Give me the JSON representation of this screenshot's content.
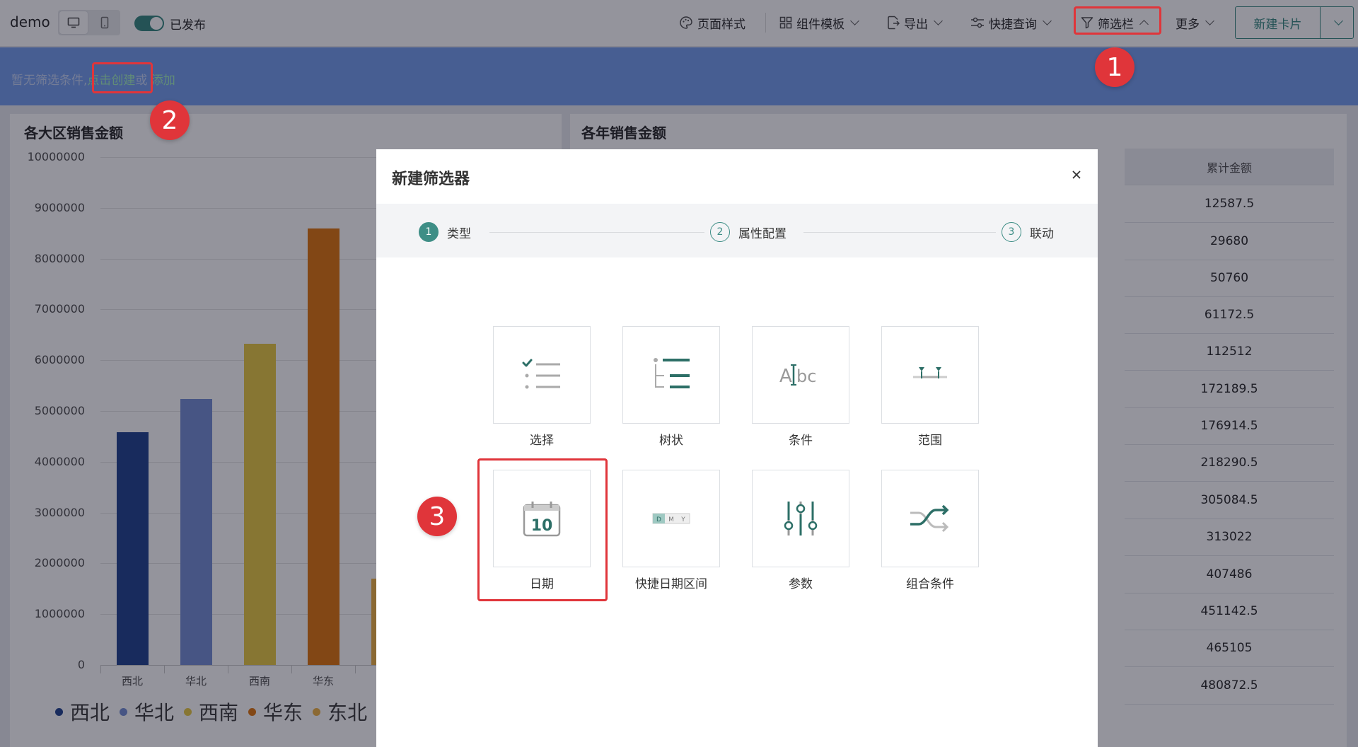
{
  "topbar": {
    "title": "demo",
    "publish_label": "已发布",
    "page_style": "页面样式",
    "component_template": "组件模板",
    "export": "导出",
    "quick_query": "快捷查询",
    "filter_bar": "筛选栏",
    "more": "更多",
    "new_card": "新建卡片"
  },
  "filterbar": {
    "empty_text": "暂无筛选条件,",
    "create_link": "点击创建",
    "or_text": "或",
    "add_link": "添加"
  },
  "left_panel": {
    "title": "各大区销售金额",
    "legend": [
      {
        "name": "西北",
        "color": "#2a4b93"
      },
      {
        "name": "华北",
        "color": "#7a93d6"
      },
      {
        "name": "西南",
        "color": "#e8cc4a"
      },
      {
        "name": "华东",
        "color": "#e07a18"
      },
      {
        "name": "东北",
        "color": "#f0b54a"
      }
    ]
  },
  "chart_data": {
    "type": "bar",
    "title": "各大区销售金额",
    "categories": [
      "西北",
      "华北",
      "西南",
      "华东",
      "东北"
    ],
    "values": [
      4580000,
      5230000,
      6330000,
      8600000,
      1700000
    ],
    "colors": [
      "#2a4b93",
      "#7a93d6",
      "#e8cc4a",
      "#e07a18",
      "#f0b54a"
    ],
    "ylim": [
      0,
      10000000
    ],
    "yticks": [
      "10000000",
      "9000000",
      "8000000",
      "7000000",
      "6000000",
      "5000000",
      "4000000",
      "3000000",
      "2000000",
      "1000000",
      "0"
    ],
    "grid": true
  },
  "right_panel": {
    "title": "各年销售金额",
    "column_header": "累计金额",
    "rows": [
      "12587.5",
      "29680",
      "50760",
      "61172.5",
      "112512",
      "172189.5",
      "176914.5",
      "218290.5",
      "305084.5",
      "313022",
      "407486",
      "451142.5",
      "465105",
      "480872.5"
    ]
  },
  "modal": {
    "title": "新建筛选器",
    "steps": [
      {
        "num": "1",
        "label": "类型"
      },
      {
        "num": "2",
        "label": "属性配置"
      },
      {
        "num": "3",
        "label": "联动"
      }
    ],
    "tiles": [
      {
        "label": "选择",
        "icon": "select-list-icon"
      },
      {
        "label": "树状",
        "icon": "tree-icon"
      },
      {
        "label": "条件",
        "icon": "text-condition-icon"
      },
      {
        "label": "范围",
        "icon": "range-icon"
      },
      {
        "label": "日期",
        "icon": "calendar-icon",
        "icon_text": "10"
      },
      {
        "label": "快捷日期区间",
        "icon": "quick-date-range-icon",
        "icon_text": [
          "D",
          "M",
          "Y"
        ]
      },
      {
        "label": "参数",
        "icon": "parameter-slider-icon"
      },
      {
        "label": "组合条件",
        "icon": "combined-condition-icon"
      }
    ]
  },
  "annotations": [
    "1",
    "2",
    "3"
  ],
  "colors": {
    "accent": "#3e8e86",
    "highlight": "#e0353a",
    "filterbar": "#7aa3ee"
  }
}
